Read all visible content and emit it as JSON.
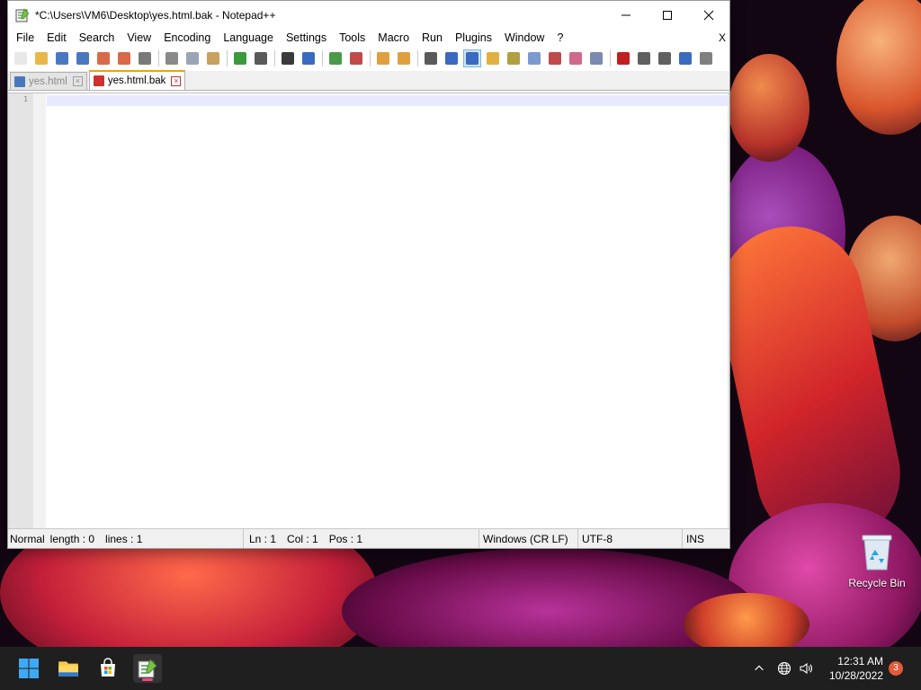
{
  "window": {
    "title": "*C:\\Users\\VM6\\Desktop\\yes.html.bak - Notepad++",
    "minimize_icon": "minimize-icon",
    "maximize_icon": "maximize-icon",
    "close_icon": "close-icon"
  },
  "menu": {
    "items": [
      "File",
      "Edit",
      "Search",
      "View",
      "Encoding",
      "Language",
      "Settings",
      "Tools",
      "Macro",
      "Run",
      "Plugins",
      "Window",
      "?"
    ],
    "close_label": "X"
  },
  "toolbar": {
    "buttons": [
      {
        "icon": "new-file-icon",
        "color": "#e8e8e8"
      },
      {
        "icon": "open-file-icon",
        "color": "#e8b84a"
      },
      {
        "icon": "save-icon",
        "color": "#4a78c0"
      },
      {
        "icon": "save-all-icon",
        "color": "#4a78c0"
      },
      {
        "icon": "close-file-icon",
        "color": "#d86a4a"
      },
      {
        "icon": "close-all-icon",
        "color": "#d86a4a"
      },
      {
        "icon": "print-icon",
        "color": "#7a7a7a"
      },
      {
        "icon": "cut-icon",
        "color": "#8a8a8a"
      },
      {
        "icon": "copy-icon",
        "color": "#9aa4b4"
      },
      {
        "icon": "paste-icon",
        "color": "#c8a060"
      },
      {
        "icon": "undo-icon",
        "color": "#3a9a3a"
      },
      {
        "icon": "redo-icon",
        "color": "#5a5a5a"
      },
      {
        "icon": "find-icon",
        "color": "#3a3a3a"
      },
      {
        "icon": "replace-icon",
        "color": "#3a6ac0"
      },
      {
        "icon": "zoom-in-icon",
        "color": "#4a9a4a"
      },
      {
        "icon": "zoom-out-icon",
        "color": "#c04a4a"
      },
      {
        "icon": "sync-vertical-icon",
        "color": "#e0a040"
      },
      {
        "icon": "sync-horizontal-icon",
        "color": "#e0a040"
      },
      {
        "icon": "word-wrap-icon",
        "color": "#5a5a5a"
      },
      {
        "icon": "show-all-chars-icon",
        "color": "#3a6ac0"
      },
      {
        "icon": "indent-guide-icon",
        "color": "#3a6ac0",
        "active": true
      },
      {
        "icon": "define-language-icon",
        "color": "#e0b040"
      },
      {
        "icon": "doc-map-icon",
        "color": "#b0a040"
      },
      {
        "icon": "doc-list-icon",
        "color": "#7a9ad0"
      },
      {
        "icon": "function-list-icon",
        "color": "#c04a4a"
      },
      {
        "icon": "folder-workspace-icon",
        "color": "#d06a8a"
      },
      {
        "icon": "monitoring-icon",
        "color": "#7a8ab0"
      },
      {
        "icon": "record-macro-icon",
        "color": "#c02020"
      },
      {
        "icon": "stop-record-icon",
        "color": "#606060"
      },
      {
        "icon": "playback-macro-icon",
        "color": "#606060"
      },
      {
        "icon": "run-macro-multiple-icon",
        "color": "#3a6ac0"
      },
      {
        "icon": "save-macro-icon",
        "color": "#808080"
      }
    ]
  },
  "tabs": [
    {
      "label": "yes.html",
      "active": false,
      "icon_color": "#4a78c0"
    },
    {
      "label": "yes.html.bak",
      "active": true,
      "icon_color": "#d03030"
    }
  ],
  "editor": {
    "line_numbers": [
      "1"
    ]
  },
  "statusbar": {
    "mode": "Normal",
    "length": "length : 0",
    "lines": "lines : 1",
    "ln": "Ln : 1",
    "col": "Col : 1",
    "pos": "Pos : 1",
    "eol": "Windows (CR LF)",
    "encoding": "UTF-8",
    "insert_mode": "INS"
  },
  "desktop": {
    "recycle_bin_label": "Recycle Bin"
  },
  "taskbar": {
    "icons": [
      "windows-start-icon",
      "file-explorer-icon",
      "microsoft-store-icon",
      "notepadpp-icon"
    ],
    "time": "12:31 AM",
    "date": "10/28/2022",
    "notification_count": "3"
  }
}
